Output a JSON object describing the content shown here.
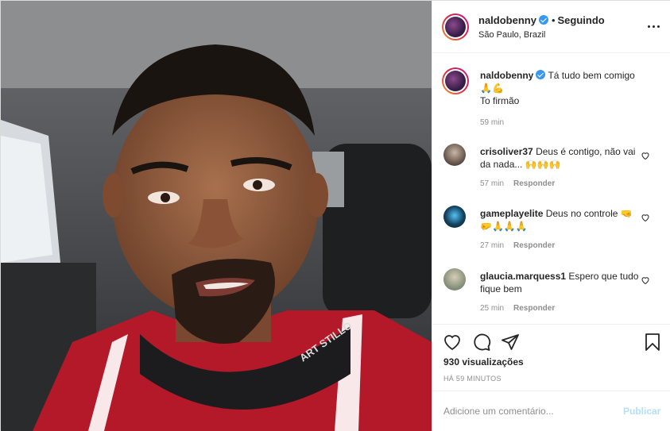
{
  "post": {
    "username": "naldobenny",
    "follow_separator": "•",
    "follow_status": "Seguindo",
    "location": "São Paulo, Brazil"
  },
  "caption": {
    "username": "naldobenny",
    "line1": "Tá tudo bem comigo",
    "emojis": "🙏💪",
    "line2": "To firmão",
    "time": "59 min"
  },
  "comments": [
    {
      "username": "crisoliver37",
      "text": "Deus é contigo, não vai da nada... 🙌🙌🙌",
      "time": "57 min",
      "reply": "Responder"
    },
    {
      "username": "gameplayelite",
      "text": "Deus no controle 🤜🤛🙏🙏🙏",
      "time": "27 min",
      "reply": "Responder"
    },
    {
      "username": "glaucia.marquess1",
      "text": "Espero que tudo fique bem",
      "time": "25 min",
      "reply": "Responder"
    }
  ],
  "stats": {
    "views": "930 visualizações",
    "posted": "HÁ 59 MINUTOS"
  },
  "add_comment": {
    "placeholder": "Adicione um comentário...",
    "publish": "Publicar"
  },
  "media": {
    "jersey_brand": "ART STILLO"
  },
  "icons": [
    "more-icon",
    "verified-icon",
    "heart-icon",
    "comment-icon",
    "share-icon",
    "bookmark-icon"
  ],
  "colors": {
    "verified": "#3897f0",
    "publish_disabled": "#b2dffc",
    "muted": "#8e8e8e"
  }
}
